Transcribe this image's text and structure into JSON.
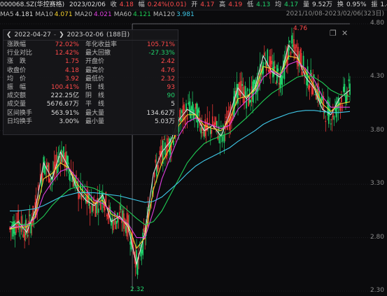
{
  "topbar": {
    "code": "000068.SZ(华控赛格)",
    "date": "2023/02/06",
    "close_label": "收",
    "close_val": "4.18",
    "chg_label": "幅",
    "chg_val": "0.24%(0.01)",
    "open_label": "开",
    "open_val": "4.17",
    "high_label": "高",
    "high_val": "4.19",
    "low_label": "低",
    "low_val": "4.13",
    "avg_label": "均",
    "avg_val": "4.17",
    "vol_label": "量",
    "vol_val": "9.52万",
    "turnover_label": "换",
    "turnover_val": "0.95%",
    "amp_label": "振",
    "amp_val": "1.44%"
  },
  "range_text": "2021/10/08-2023/02/06(323日)",
  "ma": [
    {
      "label": "MA5",
      "value": "4.181",
      "color": "#dcdcdc"
    },
    {
      "label": "MA10",
      "value": "4.071",
      "color": "#f5d22e"
    },
    {
      "label": "MA20",
      "value": "4.021",
      "color": "#e040e0"
    },
    {
      "label": "MA60",
      "value": "4.121",
      "color": "#1fcc55"
    },
    {
      "label": "MA120",
      "value": "3.981",
      "color": "#3fc8e8"
    }
  ],
  "panel": {
    "start": "2022-04-27",
    "end": "2023-02-06",
    "days": "(188日)",
    "rows": [
      {
        "l": "涨跌幅",
        "v": "72.02%",
        "vc": "red",
        "l2": "年化收益率",
        "v2": "105.71%",
        "v2c": "red"
      },
      {
        "l": "行业对比",
        "v": "12.42%",
        "vc": "red",
        "l2": "最大回撤",
        "v2": "-27.33%",
        "v2c": "green"
      },
      {
        "l": "涨　跌",
        "v": "1.75",
        "vc": "red",
        "l2": "开盘价",
        "v2": "2.42",
        "v2c": "red"
      },
      {
        "l": "收盘价",
        "v": "4.18",
        "vc": "red",
        "l2": "最高价",
        "v2": "4.76",
        "v2c": "red"
      },
      {
        "l": "均　价",
        "v": "3.92",
        "vc": "red",
        "l2": "最低价",
        "v2": "2.32",
        "v2c": "red"
      },
      {
        "l": "振　幅",
        "v": "100.41%",
        "vc": "red",
        "l2": "阳　线",
        "v2": "93",
        "v2c": "red"
      },
      {
        "l": "成交额",
        "v": "222.25亿",
        "vc": "white",
        "l2": "阴　线",
        "v2": "90",
        "v2c": "green"
      },
      {
        "l": "成交量",
        "v": "5676.67万",
        "vc": "white",
        "l2": "平　线",
        "v2": "5",
        "v2c": "white"
      },
      {
        "l": "区间换手",
        "v": "563.91%",
        "vc": "white",
        "l2": "最大量",
        "v2": "134.62万",
        "v2c": "white"
      },
      {
        "l": "日均换手",
        "v": "3.00%",
        "vc": "white",
        "l2": "最小量",
        "v2": "5.03万",
        "v2c": "white"
      }
    ]
  },
  "y_axis": [
    "4.80",
    "4.30",
    "3.80",
    "3.30",
    "2.80",
    "2.30"
  ],
  "annotations": {
    "high": "4.76",
    "low": "2.32"
  },
  "chart_data": {
    "type": "line",
    "title": "",
    "ylim": [
      2.3,
      4.8
    ],
    "x": [
      0,
      8,
      16,
      24,
      32,
      40,
      48,
      56,
      64,
      72,
      80,
      88,
      96,
      104,
      112,
      120,
      128,
      136,
      144,
      152,
      160,
      168,
      176,
      184,
      192,
      200,
      208,
      216,
      224,
      232,
      240,
      248,
      256,
      264,
      272,
      280,
      288,
      296,
      304,
      312,
      322
    ],
    "series": [
      {
        "values": [
          2.88,
          2.95,
          2.85,
          3.05,
          3.5,
          3.35,
          3.6,
          3.45,
          3.25,
          3.15,
          3.1,
          3.2,
          2.95,
          3.0,
          2.9,
          2.55,
          2.85,
          3.4,
          3.6,
          3.7,
          3.9,
          4.0,
          3.95,
          3.8,
          3.85,
          3.75,
          3.95,
          4.2,
          4.1,
          4.2,
          4.5,
          4.35,
          4.3,
          4.6,
          4.5,
          4.3,
          4.2,
          4.0,
          3.95,
          4.1,
          4.18
        ]
      },
      {
        "values": [
          2.88,
          2.9,
          2.9,
          3.0,
          3.35,
          3.4,
          3.5,
          3.45,
          3.3,
          3.2,
          3.12,
          3.15,
          3.02,
          2.98,
          2.92,
          2.7,
          2.8,
          3.25,
          3.5,
          3.65,
          3.85,
          3.95,
          3.95,
          3.85,
          3.82,
          3.8,
          3.9,
          4.1,
          4.12,
          4.18,
          4.4,
          4.38,
          4.32,
          4.5,
          4.48,
          4.35,
          4.22,
          4.05,
          3.98,
          4.05,
          4.07
        ]
      },
      {
        "values": [
          2.9,
          2.9,
          2.92,
          2.98,
          3.2,
          3.32,
          3.42,
          3.45,
          3.35,
          3.25,
          3.15,
          3.12,
          3.05,
          2.98,
          2.93,
          2.8,
          2.8,
          3.05,
          3.35,
          3.55,
          3.75,
          3.88,
          3.92,
          3.88,
          3.85,
          3.82,
          3.85,
          4.0,
          4.08,
          4.15,
          4.3,
          4.36,
          4.32,
          4.42,
          4.45,
          4.38,
          4.28,
          4.12,
          4.02,
          4.02,
          4.02
        ]
      },
      {
        "values": [
          2.95,
          2.93,
          2.92,
          2.93,
          3.0,
          3.1,
          3.18,
          3.25,
          3.28,
          3.28,
          3.26,
          3.22,
          3.18,
          3.12,
          3.05,
          2.98,
          2.92,
          2.95,
          3.05,
          3.2,
          3.35,
          3.5,
          3.6,
          3.68,
          3.72,
          3.75,
          3.78,
          3.85,
          3.92,
          4.0,
          4.08,
          4.15,
          4.2,
          4.25,
          4.3,
          4.32,
          4.3,
          4.25,
          4.18,
          4.14,
          4.12
        ]
      },
      {
        "values": [
          3.05,
          3.05,
          3.06,
          3.07,
          3.1,
          3.14,
          3.18,
          3.2,
          3.22,
          3.22,
          3.22,
          3.21,
          3.2,
          3.19,
          3.17,
          3.15,
          3.13,
          3.14,
          3.18,
          3.25,
          3.32,
          3.4,
          3.47,
          3.52,
          3.56,
          3.6,
          3.64,
          3.7,
          3.75,
          3.8,
          3.86,
          3.9,
          3.93,
          3.96,
          3.98,
          3.99,
          3.99,
          3.98,
          3.97,
          3.97,
          3.98
        ]
      }
    ]
  },
  "icons": {
    "back": "chevron-left-icon",
    "fwd": "chevron-right-icon",
    "restore": "restore-icon",
    "close": "close-icon"
  }
}
